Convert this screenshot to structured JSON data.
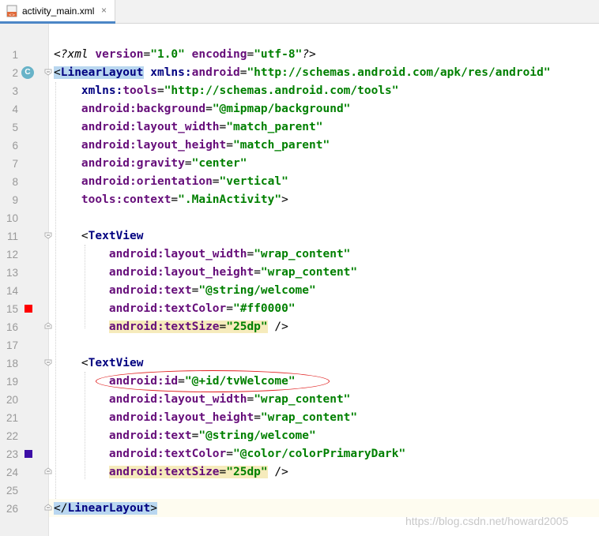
{
  "tab": {
    "filename": "activity_main.xml",
    "close": "×",
    "icon": "xml-file-icon"
  },
  "gutter": {
    "line_numbers": [
      "1",
      "2",
      "3",
      "4",
      "5",
      "6",
      "7",
      "8",
      "9",
      "10",
      "11",
      "12",
      "13",
      "14",
      "15",
      "16",
      "17",
      "18",
      "19",
      "20",
      "21",
      "22",
      "23",
      "24",
      "25",
      "26"
    ],
    "class_badge": "C",
    "swatch_line15_color": "#ff0000",
    "swatch_line23_color": "#3c0ea6"
  },
  "code": {
    "l1": {
      "a": "<?xml ",
      "b": "version",
      "c": "=",
      "d": "\"1.0\"",
      "e": " ",
      "f": "encoding",
      "g": "=",
      "h": "\"utf-8\"",
      "i": "?>"
    },
    "l2": {
      "lt": "<",
      "tag": "LinearLayout",
      "ns": " xmlns:",
      "attr": "android",
      "eq": "=",
      "val": "\"http://schemas.android.com/apk/res/android\""
    },
    "l3": {
      "ns": "xmlns:",
      "attr": "tools",
      "eq": "=",
      "val": "\"http://schemas.android.com/tools\""
    },
    "l4": {
      "ns": "android:",
      "attr": "background",
      "eq": "=",
      "val": "\"@mipmap/background\""
    },
    "l5": {
      "ns": "android:",
      "attr": "layout_width",
      "eq": "=",
      "val": "\"match_parent\""
    },
    "l6": {
      "ns": "android:",
      "attr": "layout_height",
      "eq": "=",
      "val": "\"match_parent\""
    },
    "l7": {
      "ns": "android:",
      "attr": "gravity",
      "eq": "=",
      "val": "\"center\""
    },
    "l8": {
      "ns": "android:",
      "attr": "orientation",
      "eq": "=",
      "val": "\"vertical\""
    },
    "l9": {
      "ns": "tools:",
      "attr": "context",
      "eq": "=",
      "val": "\".MainActivity\"",
      "end": ">"
    },
    "l11": {
      "lt": "<",
      "tag": "TextView"
    },
    "l12": {
      "ns": "android:",
      "attr": "layout_width",
      "eq": "=",
      "val": "\"wrap_content\""
    },
    "l13": {
      "ns": "android:",
      "attr": "layout_height",
      "eq": "=",
      "val": "\"wrap_content\""
    },
    "l14": {
      "ns": "android:",
      "attr": "text",
      "eq": "=",
      "val": "\"@string/welcome\""
    },
    "l15": {
      "ns": "android:",
      "attr": "textColor",
      "eq": "=",
      "val": "\"#ff0000\""
    },
    "l16": {
      "ns": "android:",
      "attr": "textSize",
      "eq": "=",
      "val": "\"25dp\"",
      "end": " />"
    },
    "l18": {
      "lt": "<",
      "tag": "TextView"
    },
    "l19": {
      "ns": "android:",
      "attr": "id",
      "eq": "=",
      "val": "\"@+id/tvWelcome\""
    },
    "l20": {
      "ns": "android:",
      "attr": "layout_width",
      "eq": "=",
      "val": "\"wrap_content\""
    },
    "l21": {
      "ns": "android:",
      "attr": "layout_height",
      "eq": "=",
      "val": "\"wrap_content\""
    },
    "l22": {
      "ns": "android:",
      "attr": "text",
      "eq": "=",
      "val": "\"@string/welcome\""
    },
    "l23": {
      "ns": "android:",
      "attr": "textColor",
      "eq": "=",
      "val": "\"@color/colorPrimaryDark\""
    },
    "l24": {
      "ns": "android:",
      "attr": "textSize",
      "eq": "=",
      "val": "\"25dp\"",
      "end": " />"
    },
    "l26": {
      "lt": "</",
      "tag": "LinearLayout",
      "end": ">"
    }
  },
  "watermark": "https://blog.csdn.net/howard2005",
  "colors": {
    "tag": "#000080",
    "attribute": "#660e7a",
    "value": "#008000",
    "annotation_ellipse": "#e02020"
  }
}
